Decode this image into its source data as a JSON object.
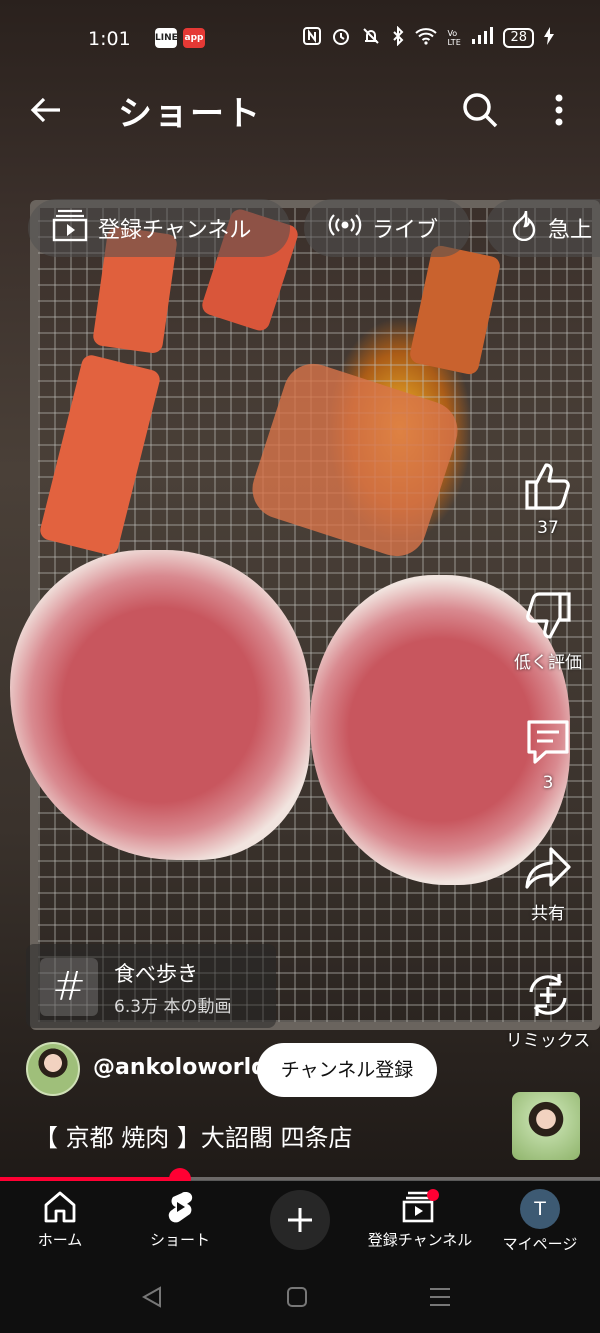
{
  "status_bar": {
    "time": "1:01",
    "app_icons": [
      "LINE",
      "app"
    ],
    "network_label": "VoLTE",
    "battery": "28"
  },
  "header": {
    "title": "ショート"
  },
  "chips": [
    {
      "label": "登録チャンネル",
      "icon": "subscriptions-icon"
    },
    {
      "label": "ライブ",
      "icon": "live-icon"
    },
    {
      "label": "急上",
      "icon": "trending-icon"
    }
  ],
  "actions": {
    "like_count": "37",
    "dislike_label": "低く評価",
    "comment_count": "3",
    "share_label": "共有",
    "remix_label": "リミックス"
  },
  "hashtag": {
    "symbol": "#",
    "name": "食べ歩き",
    "count": "6.3万 本の動画"
  },
  "channel": {
    "handle": "@ankoloworld",
    "subscribe_label": "チャンネル登録"
  },
  "video": {
    "title": "【 京都 焼肉 】大詔閣 四条店",
    "progress": 0.3
  },
  "bottom_nav": [
    {
      "label": "ホーム",
      "icon": "home-icon"
    },
    {
      "label": "ショート",
      "icon": "shorts-icon"
    },
    {
      "label": "",
      "icon": "create-icon"
    },
    {
      "label": "登録チャンネル",
      "icon": "subscriptions-icon"
    },
    {
      "label": "マイページ",
      "icon": "avatar"
    }
  ],
  "profile_initial": "T",
  "colors": {
    "accent": "#ff0033",
    "nav_bg": "#0f0f0f",
    "chip_bg": "#505050"
  }
}
